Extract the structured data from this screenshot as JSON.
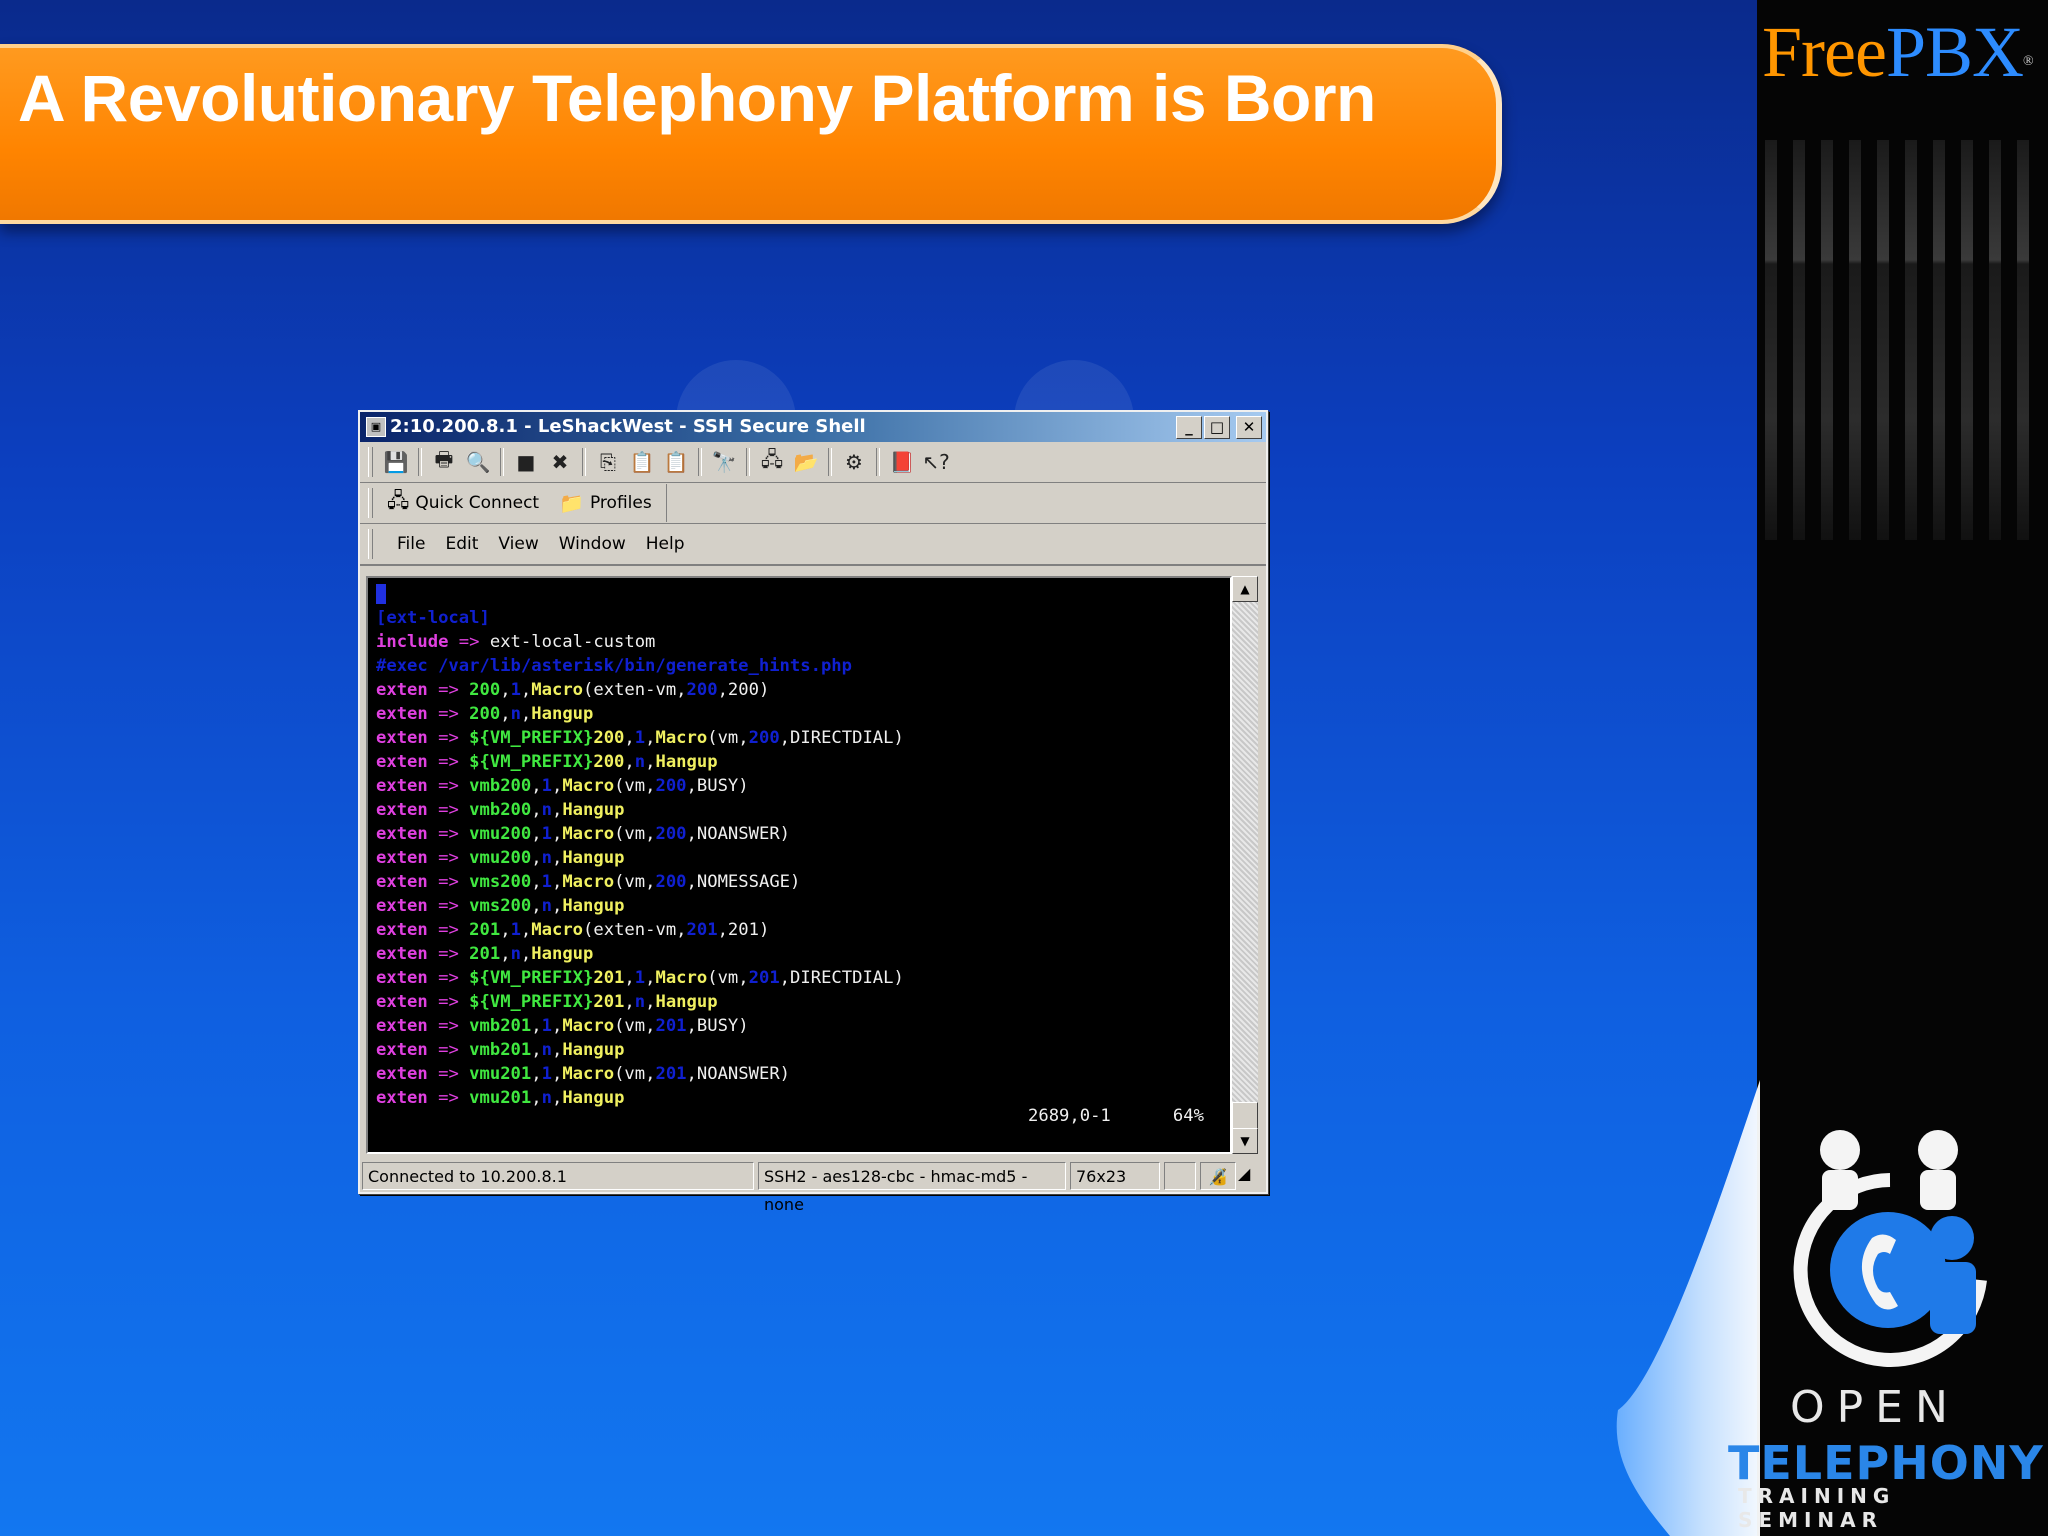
{
  "slide": {
    "title": "A Revolutionary Telephony Platform is Born",
    "brand_free": "Free",
    "brand_pbx": "PBX",
    "brand_reg": "®",
    "logo_line1": "OPEN",
    "logo_line2": "TELEPHONY",
    "logo_line3": "TRAINING SEMINAR"
  },
  "window": {
    "title": "2:10.200.8.1 - LeShackWest - SSH Secure Shell",
    "quick_connect": "Quick Connect",
    "profiles": "Profiles",
    "menu": [
      "File",
      "Edit",
      "View",
      "Window",
      "Help"
    ]
  },
  "terminal": {
    "lines": [
      [
        [
          "b",
          "[ext-local]"
        ]
      ],
      [
        [
          "k",
          "include"
        ],
        [
          "op",
          " => "
        ],
        [
          "w",
          "ext-local-custom"
        ]
      ],
      [
        [
          "b",
          "#exec /var/lib/asterisk/bin/generate_hints.php"
        ]
      ],
      [
        [
          "k",
          "exten"
        ],
        [
          "op",
          " => "
        ],
        [
          "g",
          "200"
        ],
        [
          "w",
          ","
        ],
        [
          "b",
          "1"
        ],
        [
          "w",
          ","
        ],
        [
          "y",
          "Macro"
        ],
        [
          "w",
          "(exten-vm,"
        ],
        [
          "b",
          "200"
        ],
        [
          "w",
          ",200)"
        ]
      ],
      [
        [
          "k",
          "exten"
        ],
        [
          "op",
          " => "
        ],
        [
          "g",
          "200"
        ],
        [
          "w",
          ","
        ],
        [
          "b",
          "n"
        ],
        [
          "w",
          ","
        ],
        [
          "y",
          "Hangup"
        ]
      ],
      [
        [
          "k",
          "exten"
        ],
        [
          "op",
          " => "
        ],
        [
          "g",
          "${VM_PREFIX}"
        ],
        [
          "y",
          "200"
        ],
        [
          "w",
          ","
        ],
        [
          "b",
          "1"
        ],
        [
          "w",
          ","
        ],
        [
          "y",
          "Macro"
        ],
        [
          "w",
          "(vm,"
        ],
        [
          "b",
          "200"
        ],
        [
          "w",
          ",DIRECTDIAL)"
        ]
      ],
      [
        [
          "k",
          "exten"
        ],
        [
          "op",
          " => "
        ],
        [
          "g",
          "${VM_PREFIX}"
        ],
        [
          "y",
          "200"
        ],
        [
          "w",
          ","
        ],
        [
          "b",
          "n"
        ],
        [
          "w",
          ","
        ],
        [
          "y",
          "Hangup"
        ]
      ],
      [
        [
          "k",
          "exten"
        ],
        [
          "op",
          " => "
        ],
        [
          "g",
          "vmb200"
        ],
        [
          "w",
          ","
        ],
        [
          "b",
          "1"
        ],
        [
          "w",
          ","
        ],
        [
          "y",
          "Macro"
        ],
        [
          "w",
          "(vm,"
        ],
        [
          "b",
          "200"
        ],
        [
          "w",
          ",BUSY)"
        ]
      ],
      [
        [
          "k",
          "exten"
        ],
        [
          "op",
          " => "
        ],
        [
          "g",
          "vmb200"
        ],
        [
          "w",
          ","
        ],
        [
          "b",
          "n"
        ],
        [
          "w",
          ","
        ],
        [
          "y",
          "Hangup"
        ]
      ],
      [
        [
          "k",
          "exten"
        ],
        [
          "op",
          " => "
        ],
        [
          "g",
          "vmu200"
        ],
        [
          "w",
          ","
        ],
        [
          "b",
          "1"
        ],
        [
          "w",
          ","
        ],
        [
          "y",
          "Macro"
        ],
        [
          "w",
          "(vm,"
        ],
        [
          "b",
          "200"
        ],
        [
          "w",
          ",NOANSWER)"
        ]
      ],
      [
        [
          "k",
          "exten"
        ],
        [
          "op",
          " => "
        ],
        [
          "g",
          "vmu200"
        ],
        [
          "w",
          ","
        ],
        [
          "b",
          "n"
        ],
        [
          "w",
          ","
        ],
        [
          "y",
          "Hangup"
        ]
      ],
      [
        [
          "k",
          "exten"
        ],
        [
          "op",
          " => "
        ],
        [
          "g",
          "vms200"
        ],
        [
          "w",
          ","
        ],
        [
          "b",
          "1"
        ],
        [
          "w",
          ","
        ],
        [
          "y",
          "Macro"
        ],
        [
          "w",
          "(vm,"
        ],
        [
          "b",
          "200"
        ],
        [
          "w",
          ",NOMESSAGE)"
        ]
      ],
      [
        [
          "k",
          "exten"
        ],
        [
          "op",
          " => "
        ],
        [
          "g",
          "vms200"
        ],
        [
          "w",
          ","
        ],
        [
          "b",
          "n"
        ],
        [
          "w",
          ","
        ],
        [
          "y",
          "Hangup"
        ]
      ],
      [
        [
          "k",
          "exten"
        ],
        [
          "op",
          " => "
        ],
        [
          "g",
          "201"
        ],
        [
          "w",
          ","
        ],
        [
          "b",
          "1"
        ],
        [
          "w",
          ","
        ],
        [
          "y",
          "Macro"
        ],
        [
          "w",
          "(exten-vm,"
        ],
        [
          "b",
          "201"
        ],
        [
          "w",
          ",201)"
        ]
      ],
      [
        [
          "k",
          "exten"
        ],
        [
          "op",
          " => "
        ],
        [
          "g",
          "201"
        ],
        [
          "w",
          ","
        ],
        [
          "b",
          "n"
        ],
        [
          "w",
          ","
        ],
        [
          "y",
          "Hangup"
        ]
      ],
      [
        [
          "k",
          "exten"
        ],
        [
          "op",
          " => "
        ],
        [
          "g",
          "${VM_PREFIX}"
        ],
        [
          "y",
          "201"
        ],
        [
          "w",
          ","
        ],
        [
          "b",
          "1"
        ],
        [
          "w",
          ","
        ],
        [
          "y",
          "Macro"
        ],
        [
          "w",
          "(vm,"
        ],
        [
          "b",
          "201"
        ],
        [
          "w",
          ",DIRECTDIAL)"
        ]
      ],
      [
        [
          "k",
          "exten"
        ],
        [
          "op",
          " => "
        ],
        [
          "g",
          "${VM_PREFIX}"
        ],
        [
          "y",
          "201"
        ],
        [
          "w",
          ","
        ],
        [
          "b",
          "n"
        ],
        [
          "w",
          ","
        ],
        [
          "y",
          "Hangup"
        ]
      ],
      [
        [
          "k",
          "exten"
        ],
        [
          "op",
          " => "
        ],
        [
          "g",
          "vmb201"
        ],
        [
          "w",
          ","
        ],
        [
          "b",
          "1"
        ],
        [
          "w",
          ","
        ],
        [
          "y",
          "Macro"
        ],
        [
          "w",
          "(vm,"
        ],
        [
          "b",
          "201"
        ],
        [
          "w",
          ",BUSY)"
        ]
      ],
      [
        [
          "k",
          "exten"
        ],
        [
          "op",
          " => "
        ],
        [
          "g",
          "vmb201"
        ],
        [
          "w",
          ","
        ],
        [
          "b",
          "n"
        ],
        [
          "w",
          ","
        ],
        [
          "y",
          "Hangup"
        ]
      ],
      [
        [
          "k",
          "exten"
        ],
        [
          "op",
          " => "
        ],
        [
          "g",
          "vmu201"
        ],
        [
          "w",
          ","
        ],
        [
          "b",
          "1"
        ],
        [
          "w",
          ","
        ],
        [
          "y",
          "Macro"
        ],
        [
          "w",
          "(vm,"
        ],
        [
          "b",
          "201"
        ],
        [
          "w",
          ",NOANSWER)"
        ]
      ],
      [
        [
          "k",
          "exten"
        ],
        [
          "op",
          " => "
        ],
        [
          "g",
          "vmu201"
        ],
        [
          "w",
          ","
        ],
        [
          "b",
          "n"
        ],
        [
          "w",
          ","
        ],
        [
          "y",
          "Hangup"
        ]
      ]
    ],
    "position": "2689,0-1",
    "percent": "64%"
  },
  "statusbar": {
    "connected": "Connected to 10.200.8.1",
    "cipher": "SSH2 - aes128-cbc - hmac-md5 - none",
    "size": "76x23"
  }
}
